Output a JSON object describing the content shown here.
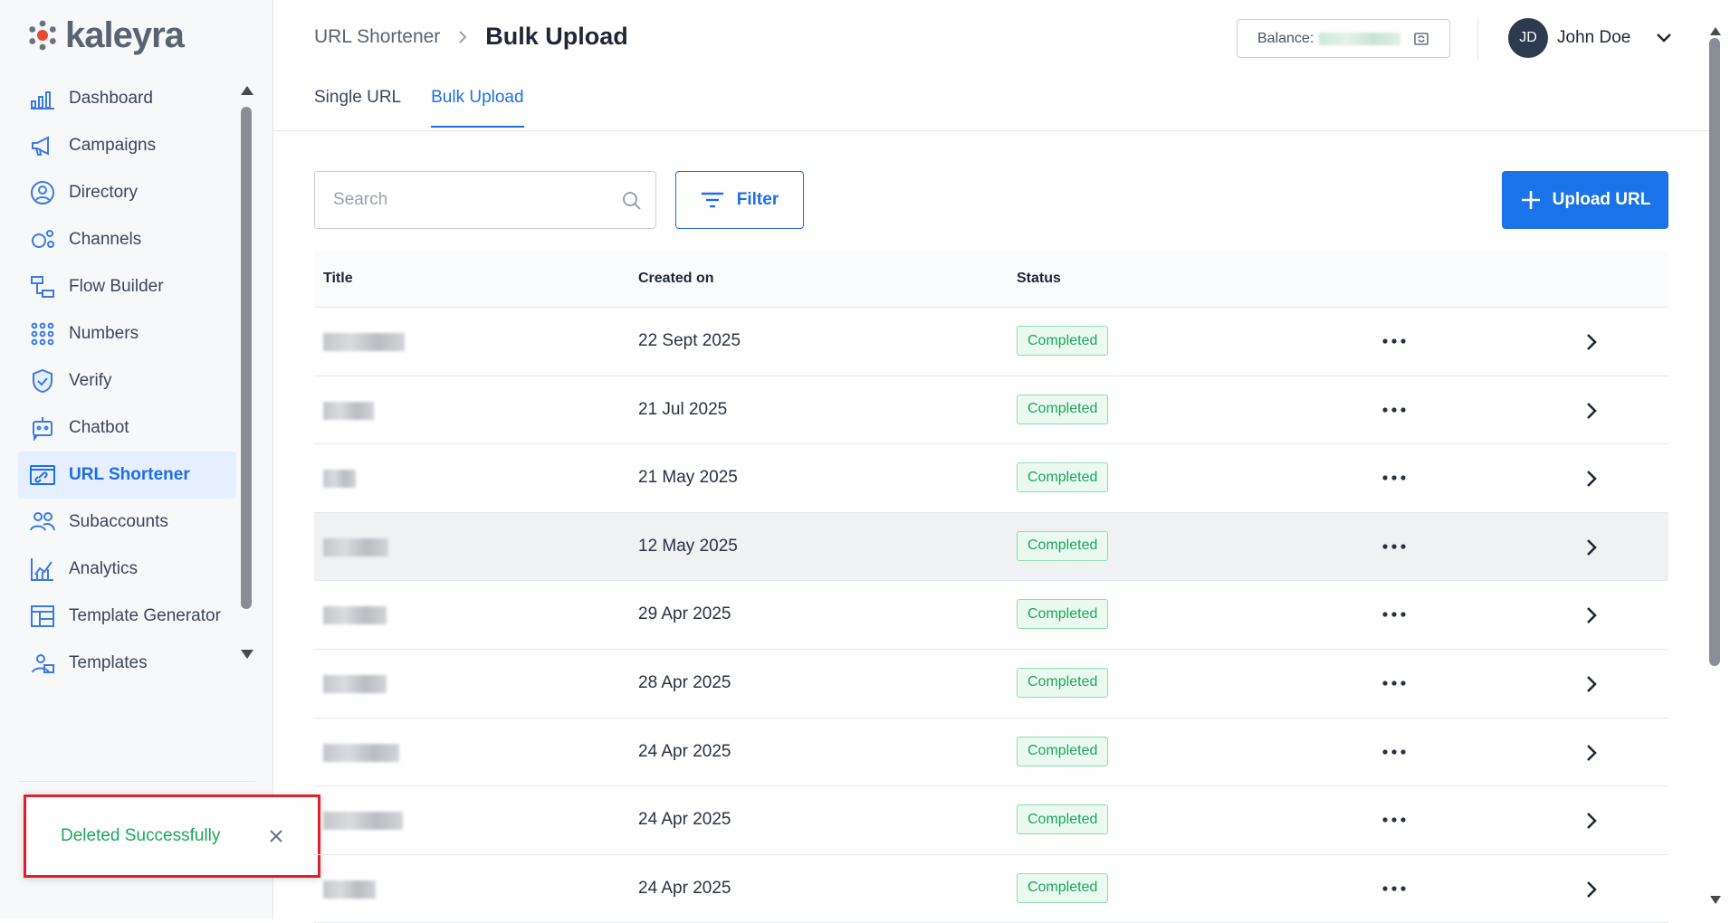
{
  "brand": {
    "name": "kaleyra"
  },
  "sidebar": {
    "items": [
      {
        "label": "Dashboard",
        "icon": "dashboard-icon"
      },
      {
        "label": "Campaigns",
        "icon": "megaphone-icon"
      },
      {
        "label": "Directory",
        "icon": "contact-icon"
      },
      {
        "label": "Channels",
        "icon": "channels-icon"
      },
      {
        "label": "Flow Builder",
        "icon": "flow-builder-icon"
      },
      {
        "label": "Numbers",
        "icon": "dial-pad-icon"
      },
      {
        "label": "Verify",
        "icon": "shield-icon"
      },
      {
        "label": "Chatbot",
        "icon": "chatbot-icon"
      },
      {
        "label": "URL Shortener",
        "icon": "link-icon",
        "active": true
      },
      {
        "label": "Subaccounts",
        "icon": "users-icon"
      },
      {
        "label": "Analytics",
        "icon": "analytics-icon"
      },
      {
        "label": "Template Generator",
        "icon": "template-generator-icon"
      },
      {
        "label": "Templates",
        "icon": "templates-icon"
      }
    ]
  },
  "toast": {
    "message": "Deleted Successfully"
  },
  "header": {
    "breadcrumb_parent": "URL Shortener",
    "breadcrumb_current": "Bulk Upload",
    "balance_label": "Balance:",
    "user_initials": "JD",
    "user_name": "John Doe"
  },
  "tabs": [
    {
      "label": "Single URL",
      "active": false
    },
    {
      "label": "Bulk Upload",
      "active": true
    }
  ],
  "toolbar": {
    "search_placeholder": "Search",
    "filter_label": "Filter",
    "upload_label": "Upload URL"
  },
  "table": {
    "columns": {
      "title": "Title",
      "created_on": "Created on",
      "status": "Status"
    },
    "rows": [
      {
        "created_on": "22 Sept 2025",
        "status": "Completed"
      },
      {
        "created_on": "21 Jul 2025",
        "status": "Completed"
      },
      {
        "created_on": "21 May 2025",
        "status": "Completed"
      },
      {
        "created_on": "12 May 2025",
        "status": "Completed"
      },
      {
        "created_on": "29 Apr 2025",
        "status": "Completed"
      },
      {
        "created_on": "28 Apr 2025",
        "status": "Completed"
      },
      {
        "created_on": "24 Apr 2025",
        "status": "Completed"
      },
      {
        "created_on": "24 Apr 2025",
        "status": "Completed"
      },
      {
        "created_on": "24 Apr 2025",
        "status": "Completed"
      }
    ]
  },
  "colors": {
    "accent": "#1e6ee8",
    "success": "#1aa75a",
    "toast_border": "#e0202a"
  }
}
